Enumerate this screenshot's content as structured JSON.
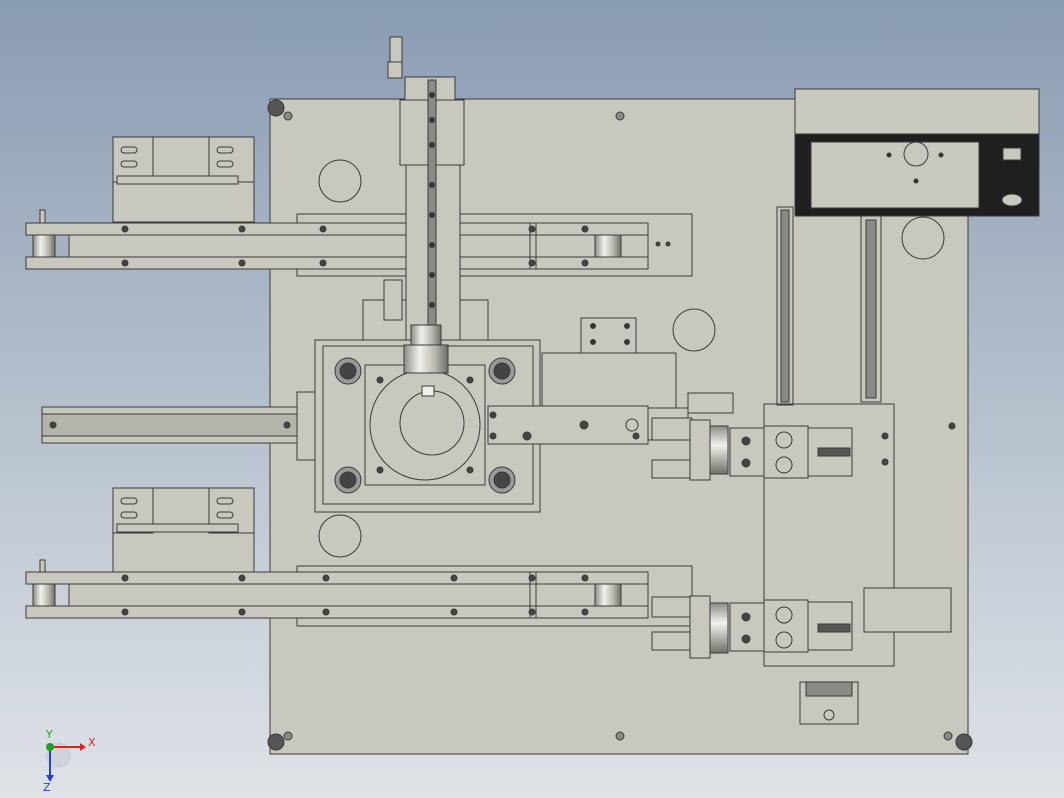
{
  "viewport": {
    "background_top": "#8a9cb3",
    "background_bottom": "#dfe3e8",
    "body_color": "#c9c8bf",
    "edge_color": "#3a3a3a"
  },
  "axis_triad": {
    "x_label": "X",
    "y_label": "Y",
    "z_label": "Z",
    "x_color": "#e02020",
    "y_color": "#20a020",
    "z_color": "#2040e0"
  }
}
